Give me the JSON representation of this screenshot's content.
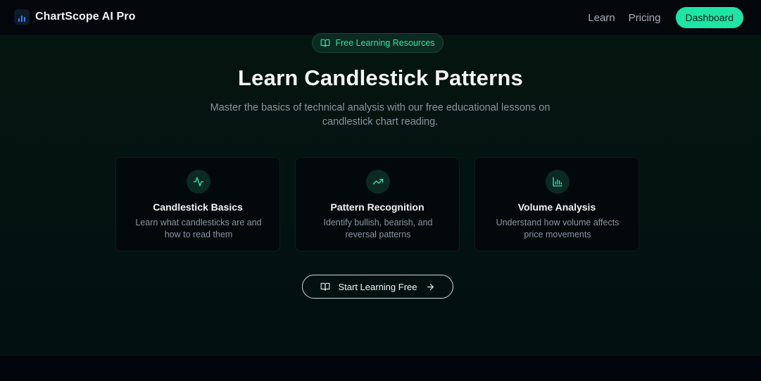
{
  "nav": {
    "brand": "ChartScope AI Pro",
    "links": [
      "Learn",
      "Pricing"
    ],
    "dashboard": "Dashboard"
  },
  "hero": {
    "badge": "Free Learning Resources",
    "title": "Learn Candlestick Patterns",
    "subtitle": "Master the basics of technical analysis with our free educational lessons on candlestick chart reading."
  },
  "cards": [
    {
      "icon": "activity-icon",
      "title": "Candlestick Basics",
      "desc": "Learn what candlesticks are and how to read them"
    },
    {
      "icon": "trending-up-icon",
      "title": "Pattern Recognition",
      "desc": "Identify bullish, bearish, and reversal patterns"
    },
    {
      "icon": "bar-chart-icon",
      "title": "Volume Analysis",
      "desc": "Understand how volume affects price movements"
    }
  ],
  "cta": {
    "label": "Start Learning Free"
  },
  "colors": {
    "accent": "#1fe4a4",
    "background": "#03130f",
    "text": "#f5f6f7",
    "muted": "#8a95a3"
  }
}
